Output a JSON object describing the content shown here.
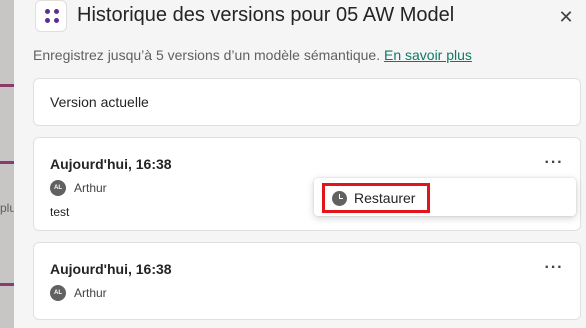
{
  "backdrop": {
    "fragment_text": "plu"
  },
  "header": {
    "title": "Historique des versions pour 05 AW Model",
    "close_symbol": "✕"
  },
  "subtitle": {
    "text": "Enregistrez jusqu’à 5 versions d’un modèle sémantique. ",
    "link": "En savoir plus"
  },
  "current_version": {
    "label": "Version actuelle"
  },
  "versions": [
    {
      "timestamp": "Aujourd'hui, 16:38",
      "avatar_initials": "AL",
      "author": "Arthur",
      "comment": "test"
    },
    {
      "timestamp": "Aujourd'hui, 16:38",
      "avatar_initials": "AL",
      "author": "Arthur",
      "comment": ""
    }
  ],
  "more_symbol": "···",
  "context_menu": {
    "items": [
      {
        "label": "Restaurer",
        "icon": "clock-icon"
      }
    ],
    "highlight_color": "#e3141b"
  },
  "colors": {
    "accent": "#5c2e91",
    "link": "#117865"
  }
}
